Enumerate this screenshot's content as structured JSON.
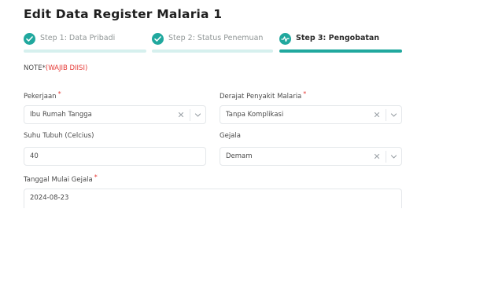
{
  "page": {
    "title": "Edit Data Register Malaria 1"
  },
  "stepper": {
    "steps": [
      {
        "label": "Step 1: Data Pribadi",
        "state": "done"
      },
      {
        "label": "Step 2: Status Penemuan",
        "state": "done"
      },
      {
        "label": "Step 3: Pengobatan",
        "state": "active"
      }
    ]
  },
  "note": {
    "prefix": "NOTE*",
    "required": "(WAJIB DIISI)"
  },
  "form": {
    "pekerjaan": {
      "label": "Pekerjaan",
      "value": "Ibu Rumah Tangga"
    },
    "derajat": {
      "label": "Derajat Penyakit Malaria",
      "value": "Tanpa Komplikasi"
    },
    "suhu": {
      "label": "Suhu Tubuh (Celcius)",
      "value": "40"
    },
    "gejala": {
      "label": "Gejala",
      "value": "Demam"
    },
    "tanggal": {
      "label": "Tanggal Mulai Gejala",
      "value": "2024-08-23"
    },
    "required_mark": "*"
  },
  "colors": {
    "accent": "#20a89e",
    "accent_light": "#d6f0ee",
    "required": "#e53935"
  }
}
